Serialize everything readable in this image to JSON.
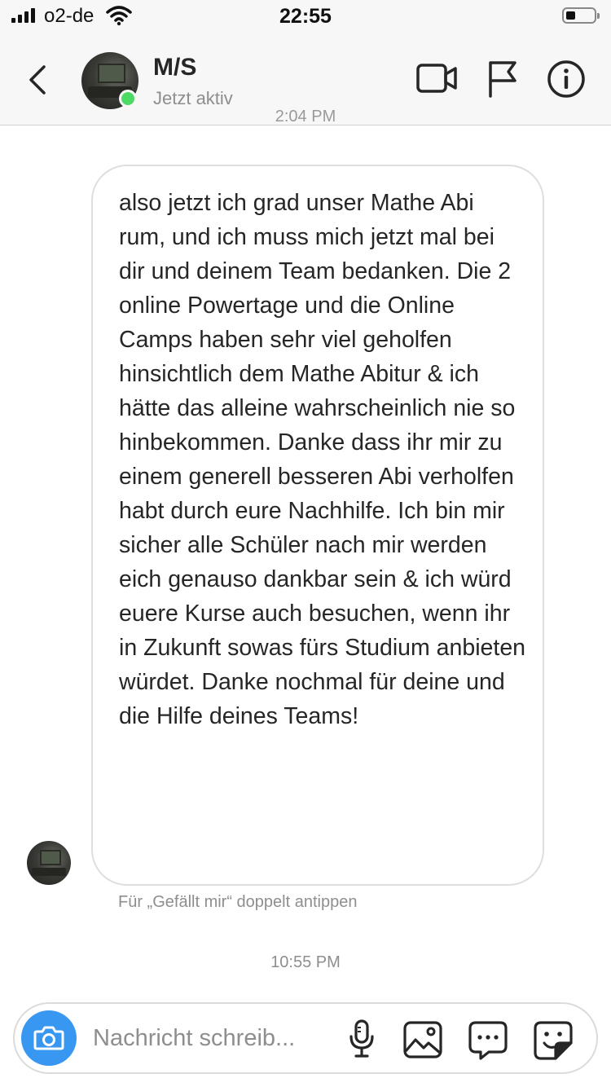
{
  "status_bar": {
    "carrier": "o2-de",
    "time": "22:55",
    "battery_level": 0.35
  },
  "header": {
    "name": "M/S",
    "status": "Jetzt aktiv"
  },
  "icons": {
    "back": "chevron-left-icon",
    "video": "video-camera-icon",
    "flag": "flag-icon",
    "info": "info-icon",
    "camera": "camera-icon",
    "mic": "microphone-icon",
    "gallery": "image-icon",
    "chat": "chat-bubble-icon",
    "sticker": "sticker-icon"
  },
  "conversation": {
    "partial_timestamp": "2:04 PM",
    "message": "also jetzt ich grad unser Mathe Abi rum, und ich muss mich jetzt mal bei dir und deinem Team bedanken. Die 2 online Powertage und die Online Camps haben sehr viel geholfen hinsichtlich dem Mathe Abitur & ich hätte das alleine wahrscheinlich nie so hinbekommen. Danke dass ihr mir zu einem generell besseren Abi verholfen habt durch eure Nachhilfe. Ich bin mir sicher alle Schüler nach mir werden eich genauso dankbar sein & ich würd euere Kurse auch besuchen, wenn ihr in Zukunft sowas fürs Studium anbieten würdet. Danke nochmal für deine und die Hilfe deines Teams!",
    "like_hint": "Für „Gefällt mir“ doppelt antippen",
    "time": "10:55 PM"
  },
  "composer": {
    "placeholder": "Nachricht schreib...",
    "value": ""
  },
  "colors": {
    "accent": "#3897f0",
    "online": "#4cd964",
    "text": "#262626",
    "muted": "#8e8e8e"
  }
}
